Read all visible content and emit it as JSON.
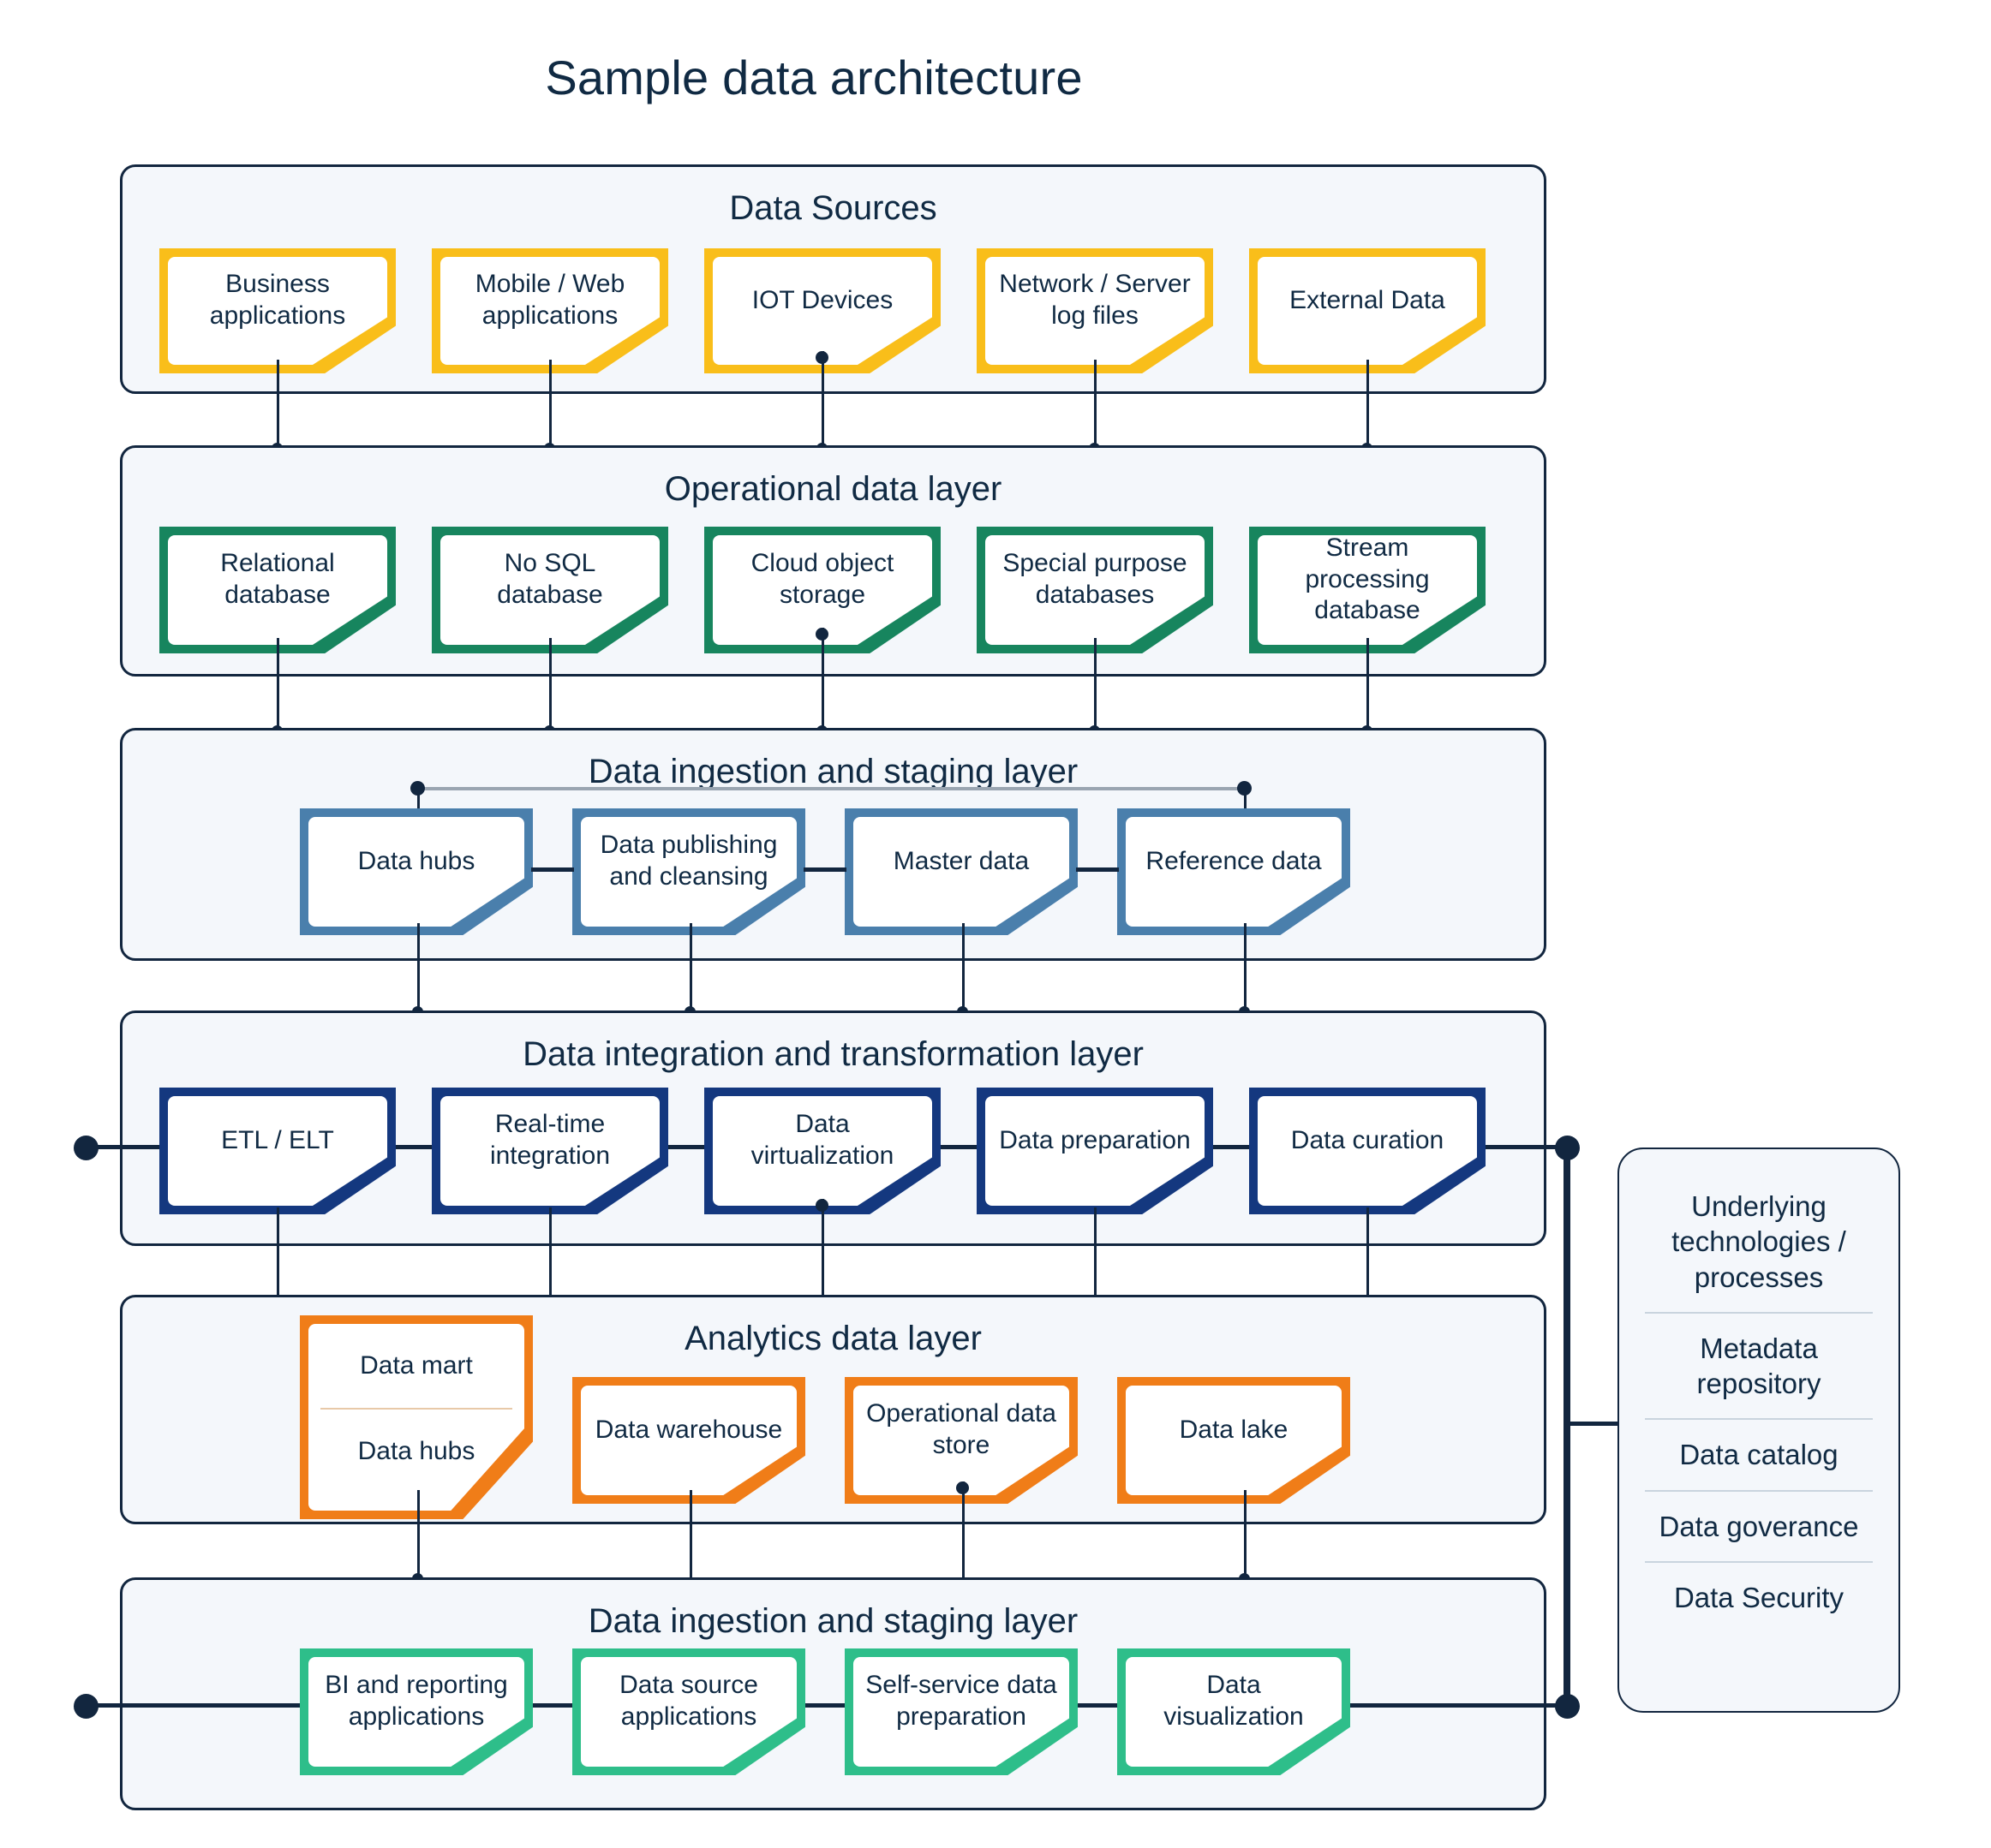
{
  "title": "Sample data architecture",
  "colors": {
    "sources": "#f9be1a",
    "operational": "#17855e",
    "ingestion": "#4a7fac",
    "integration": "#14387f",
    "analytics": "#f07d18",
    "consumption": "#2ebe8a",
    "panel_bg": "#f4f7fb",
    "outline": "#12263f",
    "text": "#102a43"
  },
  "layers": [
    {
      "id": "data-sources",
      "title": "Data Sources",
      "cards": [
        {
          "label": "Business applications"
        },
        {
          "label": "Mobile / Web applications"
        },
        {
          "label": "IOT Devices"
        },
        {
          "label": "Network / Server log files"
        },
        {
          "label": "External Data"
        }
      ]
    },
    {
      "id": "operational-data-layer",
      "title": "Operational data layer",
      "cards": [
        {
          "label": "Relational database"
        },
        {
          "label": "No SQL database"
        },
        {
          "label": "Cloud object storage"
        },
        {
          "label": "Special purpose databases"
        },
        {
          "label": "Stream processing database"
        }
      ]
    },
    {
      "id": "data-ingestion-staging-layer-top",
      "title": "Data ingestion and staging layer",
      "cards": [
        {
          "label": "Data hubs"
        },
        {
          "label": "Data publishing and cleansing"
        },
        {
          "label": "Master data"
        },
        {
          "label": "Reference data"
        }
      ]
    },
    {
      "id": "data-integration-transformation-layer",
      "title": "Data integration and transformation layer",
      "cards": [
        {
          "label": "ETL / ELT"
        },
        {
          "label": "Real-time integration"
        },
        {
          "label": "Data virtualization"
        },
        {
          "label": "Data preparation"
        },
        {
          "label": "Data curation"
        }
      ]
    },
    {
      "id": "analytics-data-layer",
      "title": "Analytics data layer",
      "cards": [
        {
          "label_top": "Data mart",
          "label_bottom": "Data hubs"
        },
        {
          "label": "Data warehouse"
        },
        {
          "label": "Operational data store"
        },
        {
          "label": "Data lake"
        }
      ]
    },
    {
      "id": "data-ingestion-staging-layer-bottom",
      "title": "Data ingestion and staging layer",
      "cards": [
        {
          "label": "BI and reporting applications"
        },
        {
          "label": "Data source applications"
        },
        {
          "label": "Self-service data preparation"
        },
        {
          "label": "Data visualization"
        }
      ]
    }
  ],
  "sidebar": {
    "heading": "Underlying technologies / processes",
    "items": [
      "Metadata repository",
      "Data catalog",
      "Data goverance",
      "Data Security"
    ]
  }
}
